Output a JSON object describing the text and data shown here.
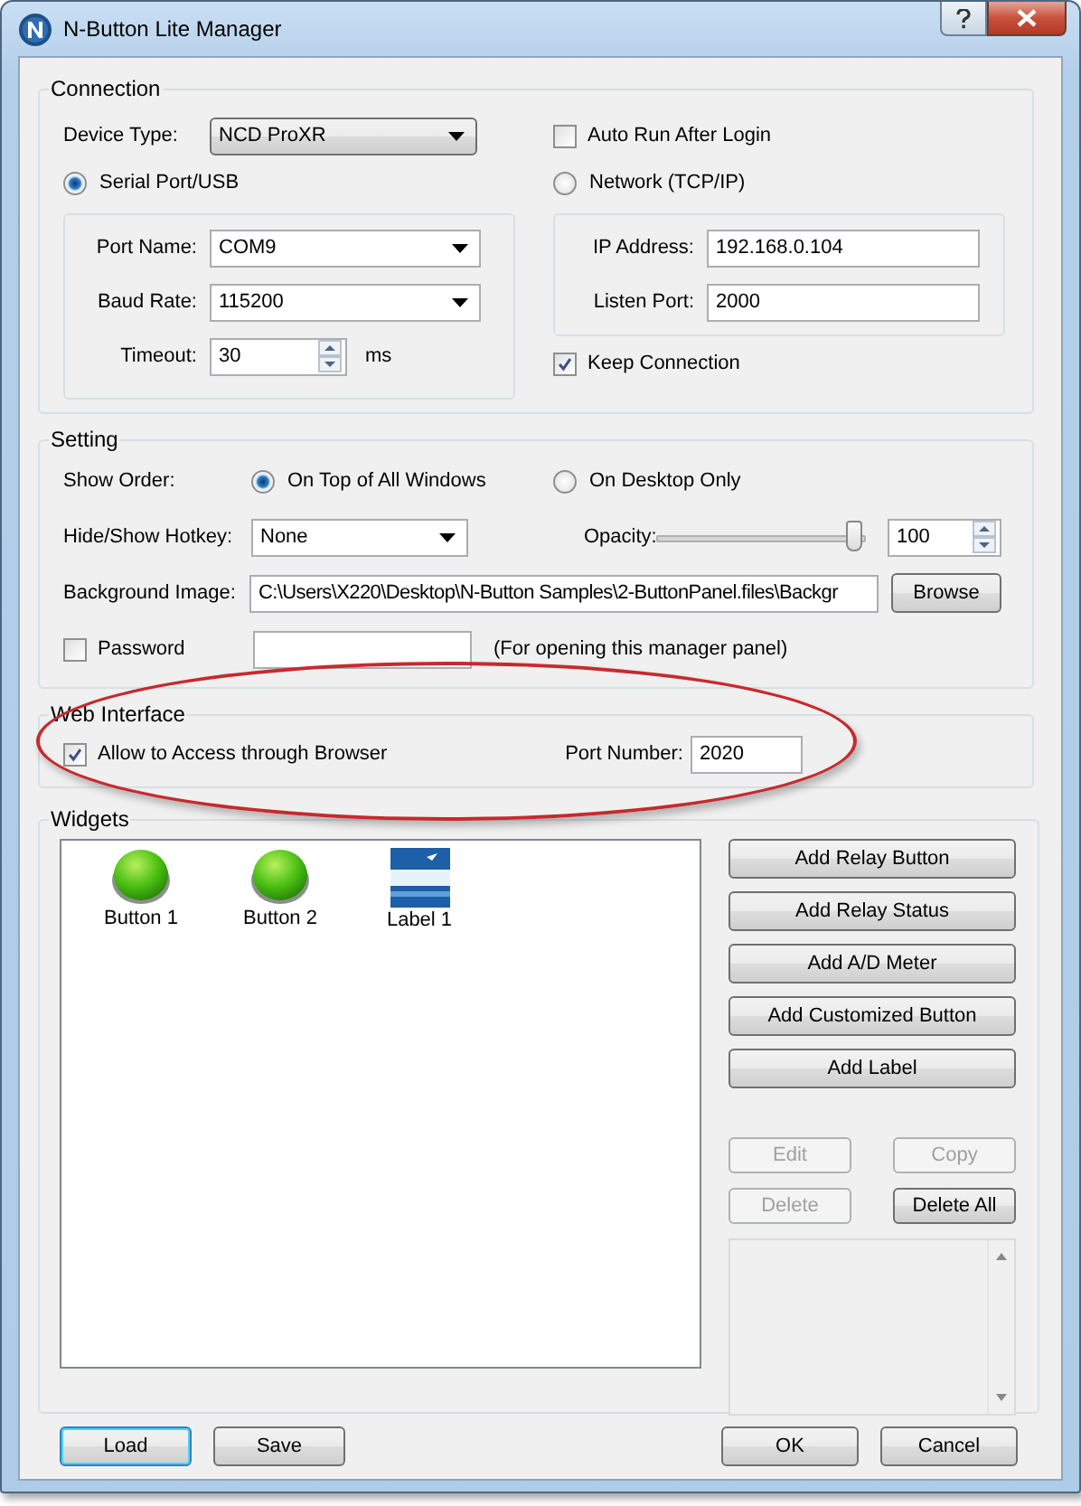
{
  "window": {
    "title": "N-Button Lite Manager"
  },
  "connection": {
    "legend": "Connection",
    "device_type": {
      "label": "Device Type:",
      "value": "NCD ProXR"
    },
    "auto_run": {
      "label": "Auto Run After Login",
      "checked": false
    },
    "modes": [
      {
        "label": "Serial Port/USB",
        "selected": true
      },
      {
        "label": "Network (TCP/IP)",
        "selected": false
      }
    ],
    "serial": [
      {
        "label": "Port Name:",
        "value": "COM9",
        "kind": "dropdown"
      },
      {
        "label": "Baud Rate:",
        "value": "115200",
        "kind": "dropdown"
      },
      {
        "label": "Timeout:",
        "value": "30",
        "kind": "spinner",
        "unit": "ms"
      }
    ],
    "network": [
      {
        "label": "IP Address:",
        "value": "192.168.0.104"
      },
      {
        "label": "Listen Port:",
        "value": "2000"
      }
    ],
    "keep_connection": {
      "label": "Keep Connection",
      "checked": true
    }
  },
  "setting": {
    "legend": "Setting",
    "show_order": {
      "label": "Show Order:",
      "options": [
        {
          "label": "On Top of All Windows",
          "selected": true
        },
        {
          "label": "On Desktop Only",
          "selected": false
        }
      ]
    },
    "hotkey": {
      "label": "Hide/Show Hotkey:",
      "value": "None"
    },
    "opacity": {
      "label": "Opacity:",
      "level": 1,
      "value": "100"
    },
    "background_image": {
      "label": "Background Image:",
      "value": "C:\\Users\\X220\\Desktop\\N-Button Samples\\2-ButtonPanel.files\\Backgr",
      "button": "Browse"
    },
    "password": {
      "label": "Password",
      "checked": false,
      "note": "(For opening this manager panel)"
    }
  },
  "web_interface": {
    "legend": "Web Interface",
    "allow": {
      "label": "Allow to Access through Browser",
      "checked": true
    },
    "port": {
      "label": "Port Number:",
      "value": "2020"
    }
  },
  "widgets": {
    "legend": "Widgets",
    "items": [
      {
        "name": "Button 1",
        "kind": "button"
      },
      {
        "name": "Button 2",
        "kind": "button"
      },
      {
        "name": "Label 1",
        "kind": "label"
      }
    ],
    "add_buttons": [
      "Add Relay Button",
      "Add Relay Status",
      "Add A/D Meter",
      "Add Customized Button",
      "Add Label"
    ],
    "edit_buttons": [
      {
        "label": "Edit",
        "disabled": true
      },
      {
        "label": "Copy",
        "disabled": true
      },
      {
        "label": "Delete",
        "disabled": true
      },
      {
        "label": "Delete All",
        "disabled": false
      }
    ]
  },
  "footer": {
    "left": [
      {
        "label": "Load",
        "focused": true
      },
      {
        "label": "Save",
        "focused": false
      }
    ],
    "right": [
      "OK",
      "Cancel"
    ]
  }
}
